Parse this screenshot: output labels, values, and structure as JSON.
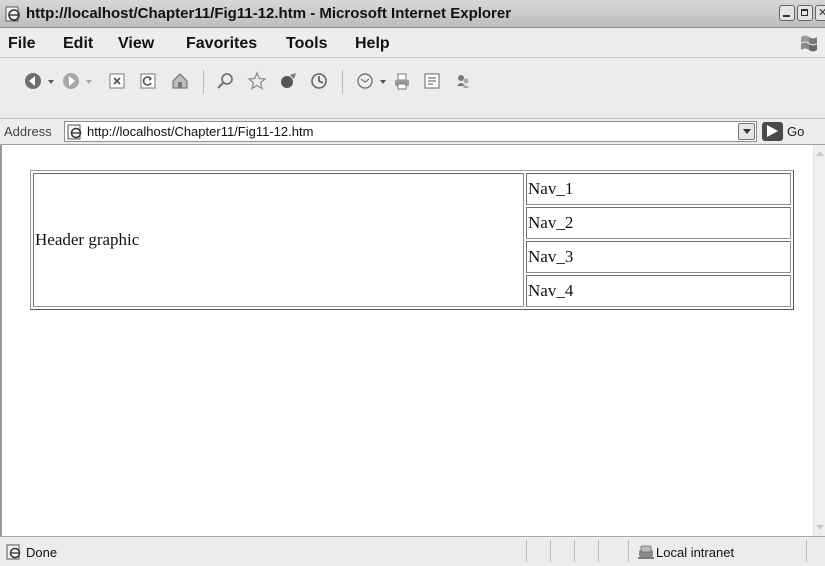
{
  "window": {
    "title": "http://localhost/Chapter11/Fig11-12.htm - Microsoft Internet Explorer"
  },
  "menu": {
    "items": [
      "File",
      "Edit",
      "View",
      "Favorites",
      "Tools",
      "Help"
    ]
  },
  "toolbar": {
    "buttons": [
      "back-icon",
      "forward-icon",
      "stop-icon",
      "refresh-icon",
      "home-icon",
      "search-icon",
      "favorites-star-icon",
      "media-icon",
      "history-icon",
      "mail-icon",
      "print-icon",
      "edit-icon",
      "messenger-icon"
    ]
  },
  "address": {
    "label": "Address",
    "url": "http://localhost/Chapter11/Fig11-12.htm",
    "go_label": "Go"
  },
  "page": {
    "header_text": "Header graphic",
    "nav": [
      "Nav_1",
      "Nav_2",
      "Nav_3",
      "Nav_4"
    ]
  },
  "status": {
    "text": "Done",
    "zone": "Local intranet"
  },
  "colors": {
    "chrome": "#ececec",
    "content_bg": "#ffffff",
    "go_button": "#4a4a4a"
  }
}
